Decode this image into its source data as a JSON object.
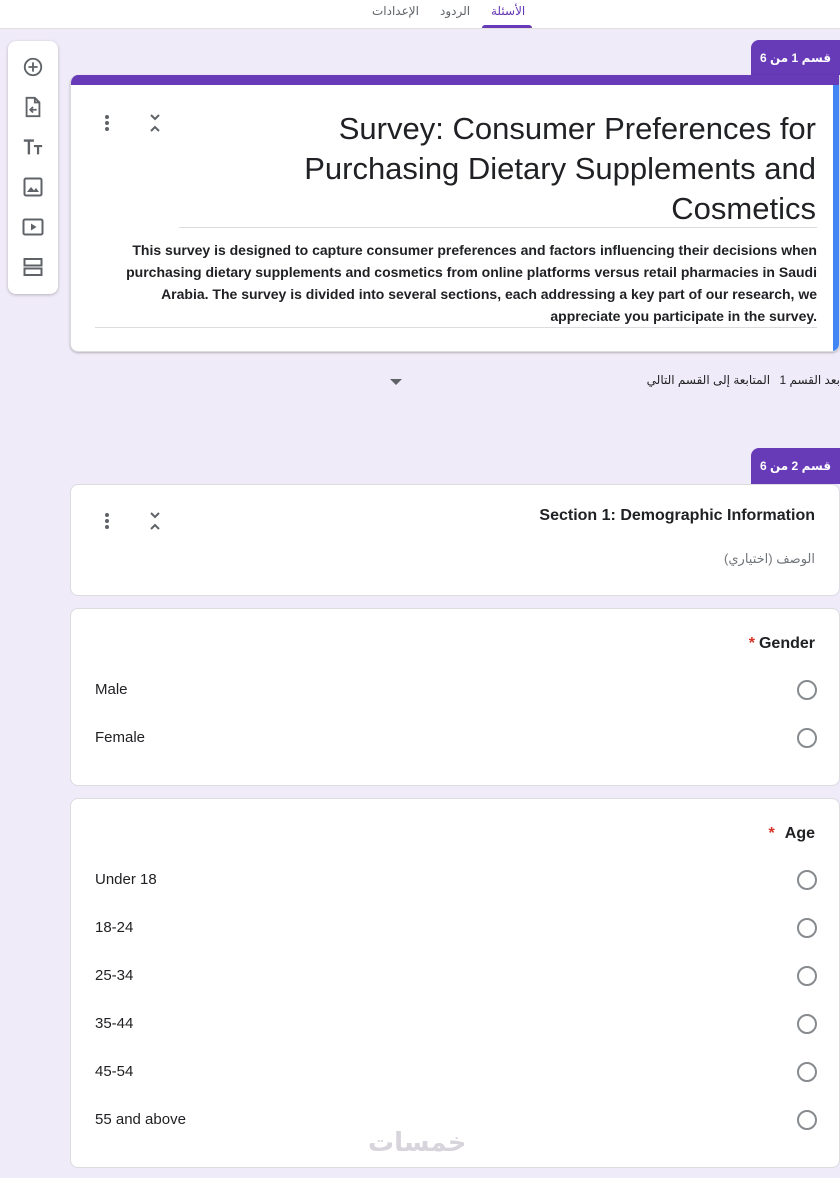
{
  "tabs": [
    {
      "label": "الأسئلة",
      "active": true
    },
    {
      "label": "الردود",
      "active": false
    },
    {
      "label": "الإعدادات",
      "active": false
    }
  ],
  "toolbar": {
    "icons": [
      "add-question-icon",
      "import-questions-icon",
      "add-title-icon",
      "add-image-icon",
      "add-video-icon",
      "add-section-icon"
    ]
  },
  "sections": [
    {
      "tag": "قسم 1 من 6"
    },
    {
      "tag": "قسم 2 من 6"
    }
  ],
  "form": {
    "title": "Survey: Consumer Preferences for Purchasing Dietary Supplements and Cosmetics",
    "description": "This survey is designed to capture consumer preferences and factors influencing their decisions when purchasing dietary supplements and cosmetics from online platforms versus retail pharmacies in Saudi Arabia. The survey is divided into several sections, each addressing a key part of our research, we appreciate you participate in the survey."
  },
  "after_section": {
    "label": "بعد القسم 1",
    "value": "المتابعة إلى القسم التالي"
  },
  "section2": {
    "title": "Section 1: Demographic Information",
    "description_placeholder": "الوصف (اختياري)"
  },
  "questions": [
    {
      "title": "Gender",
      "required": "*",
      "options": [
        "Male",
        "Female"
      ]
    },
    {
      "title": "Age",
      "required": "*",
      "options": [
        "Under 18",
        "18-24",
        "25-34",
        "35-44",
        "45-54",
        "55 and above"
      ]
    }
  ],
  "watermark": "خمسات",
  "colors": {
    "accent": "#673ab7",
    "focus": "#4285f4",
    "required": "#d93025",
    "background": "#f0ebf8"
  }
}
